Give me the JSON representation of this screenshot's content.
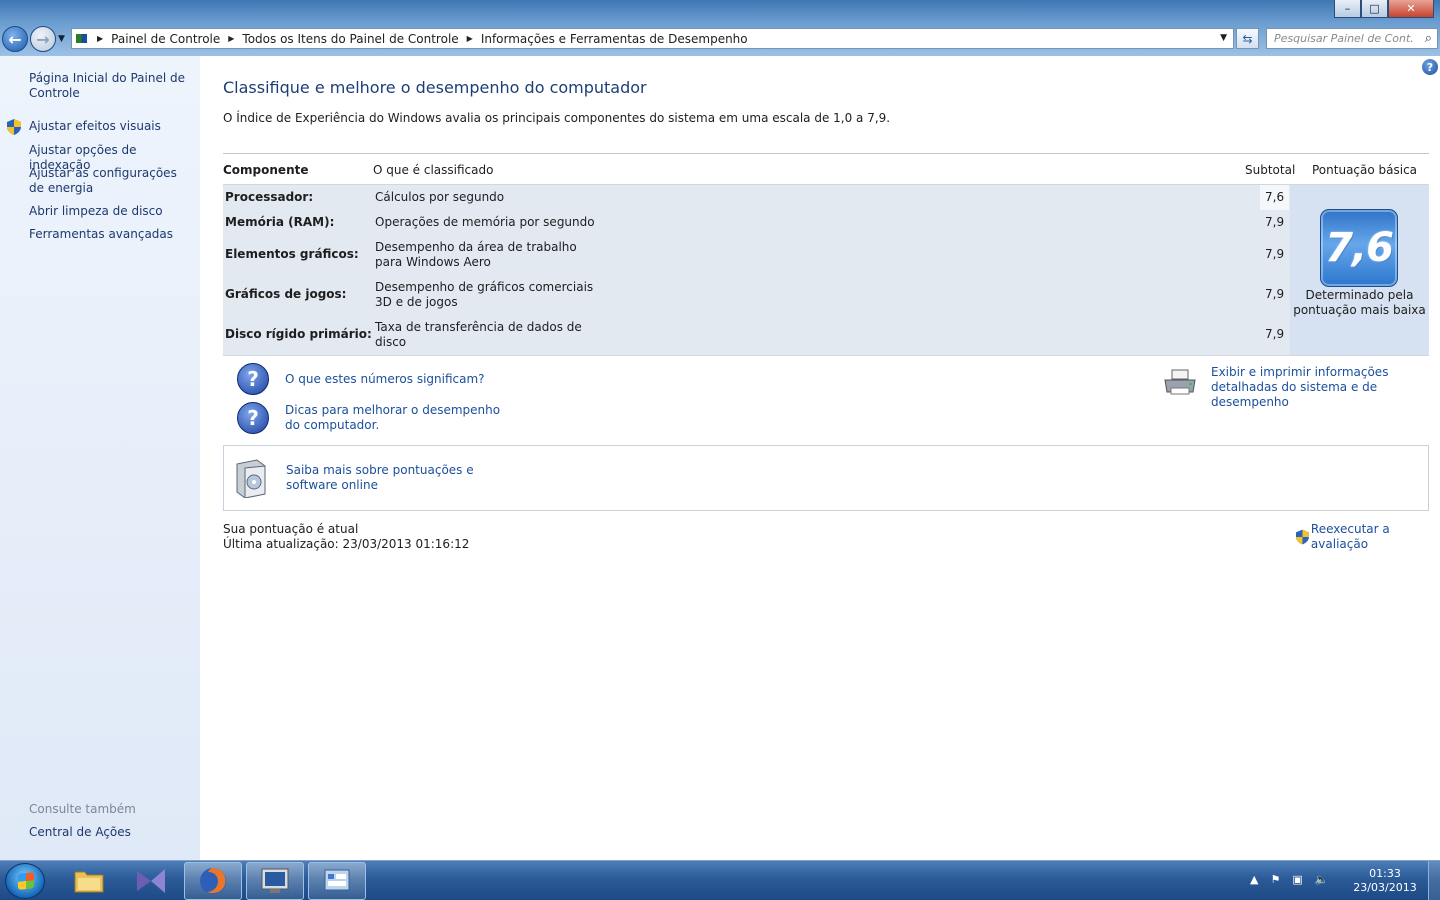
{
  "window": {
    "minimize_label": "–",
    "maximize_label": "□",
    "close_label": "✕"
  },
  "address": {
    "crumbs": [
      "Painel de Controle",
      "Todos os Itens do Painel de Controle",
      "Informações e Ferramentas de Desempenho"
    ]
  },
  "search": {
    "placeholder": "Pesquisar Painel de Cont..."
  },
  "sidebar": {
    "items": [
      {
        "label": "Página Inicial do Painel de Controle"
      },
      {
        "label": "Ajustar efeitos visuais"
      },
      {
        "label": "Ajustar opções de indexação"
      },
      {
        "label": "Ajustar as configurações de energia"
      },
      {
        "label": "Abrir limpeza de disco"
      },
      {
        "label": "Ferramentas avançadas"
      }
    ],
    "see_also_title": "Consulte também",
    "see_also_items": [
      {
        "label": "Central de Ações"
      }
    ]
  },
  "main": {
    "title": "Classifique e melhore o desempenho do computador",
    "intro": "O Índice de Experiência do Windows avalia os principais componentes do sistema em uma escala de 1,0 a 7,9.",
    "table": {
      "headers": {
        "component": "Componente",
        "rated": "O que é classificado",
        "subtotal": "Subtotal",
        "base": "Pontuação básica"
      },
      "rows": [
        {
          "component": "Processador:",
          "rated": "Cálculos por segundo",
          "subtotal": "7,6"
        },
        {
          "component": "Memória (RAM):",
          "rated": "Operações de memória por segundo",
          "subtotal": "7,9"
        },
        {
          "component": "Elementos gráficos:",
          "rated": "Desempenho da área de trabalho para Windows Aero",
          "subtotal": "7,9"
        },
        {
          "component": "Gráficos de jogos:",
          "rated": "Desempenho de gráficos comerciais 3D e de jogos",
          "subtotal": "7,9"
        },
        {
          "component": "Disco rígido primário:",
          "rated": "Taxa de transferência de dados de disco",
          "subtotal": "7,9"
        }
      ],
      "base_score": "7,6",
      "base_caption": "Determinado pela pontuação mais baixa"
    },
    "links": {
      "what_numbers_mean": "O que estes números significam?",
      "tips": "Dicas para melhorar o desempenho do computador.",
      "print_details": "Exibir e imprimir informações detalhadas do sistema e de desempenho",
      "learn_more": "Saiba mais sobre pontuações e software online"
    },
    "status": {
      "current": "Sua pontuação é atual",
      "last_update": "Última atualização: 23/03/2013 01:16:12"
    },
    "rerun_label": "Reexecutar a avaliação"
  },
  "taskbar": {
    "time": "01:33",
    "date": "23/03/2013"
  }
}
